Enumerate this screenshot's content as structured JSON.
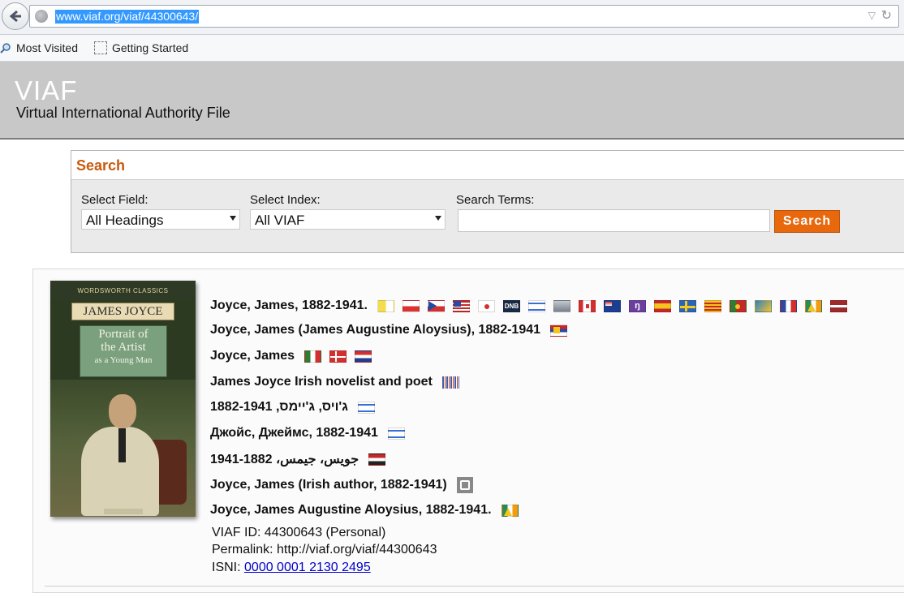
{
  "browser": {
    "url": "www.viaf.org/viaf/44300643/",
    "bookmarks": [
      {
        "label": "Most Visited",
        "icon": "most-visited-icon"
      },
      {
        "label": "Getting Started",
        "icon": "page-icon"
      }
    ]
  },
  "header": {
    "logo": "VIAF",
    "subtitle": "Virtual International Authority File"
  },
  "search": {
    "title": "Search",
    "field_label": "Select Field:",
    "field_value": "All Headings",
    "index_label": "Select Index:",
    "index_value": "All VIAF",
    "terms_label": "Search Terms:",
    "terms_value": "",
    "button_label": "Search"
  },
  "cover": {
    "series": "WORDSWORTH CLASSICS",
    "author": "JAMES JOYCE",
    "title_line1": "Portrait of",
    "title_line2": "the Artist",
    "title_line3": "as a Young Man"
  },
  "headings": [
    {
      "text": "Joyce, James, 1882-1941.",
      "flags": [
        "vatican",
        "poland",
        "czech",
        "usa",
        "japan",
        "dnb",
        "israel",
        "generic-gray",
        "canada",
        "australia",
        "nukat",
        "spain",
        "sweden",
        "catalonia",
        "portugal",
        "bne",
        "france",
        "ireland-warn",
        "latvia"
      ]
    },
    {
      "text": "Joyce, James (James Augustine Aloysius), 1882-1941",
      "flags": [
        "multi-serbia"
      ]
    },
    {
      "text": "Joyce, James",
      "flags": [
        "italy",
        "denmark",
        "croatia"
      ]
    },
    {
      "text": "James Joyce Irish novelist and poet",
      "flags": [
        "barcode"
      ]
    },
    {
      "text": "ג'ויס, ג'יימס, 1882-1941",
      "flags": [
        "israel"
      ]
    },
    {
      "text": "Джойс, Джеймс, 1882-1941",
      "flags": [
        "israel"
      ]
    },
    {
      "text": "جويس، جيمس، 1882-1941",
      "flags": [
        "egypt"
      ]
    },
    {
      "text": "Joyce, James (Irish author, 1882-1941)",
      "flags": [
        "wikidata"
      ]
    },
    {
      "text": "Joyce, James Augustine Aloysius, 1882-1941.",
      "flags": [
        "ireland-warn"
      ]
    }
  ],
  "record": {
    "viaf_id": "VIAF ID: 44300643 (Personal)",
    "permalink": "Permalink: http://viaf.org/viaf/44300643",
    "isni_label": "ISNI: ",
    "isni_value": "0000 0001 2130 2495"
  }
}
